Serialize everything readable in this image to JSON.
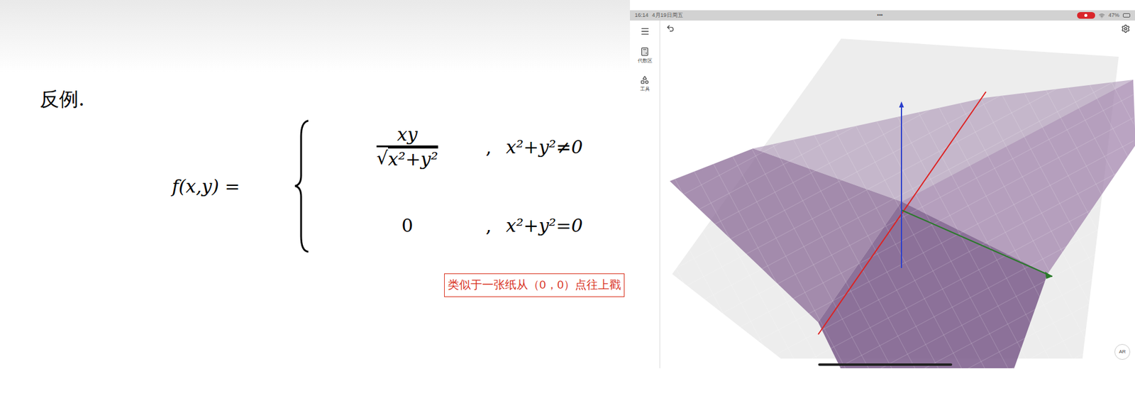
{
  "board": {
    "title": "反例.",
    "formula_lhs": "f(x,y) =",
    "cases": [
      {
        "kind": "fraction",
        "numerator": "xy",
        "radical": "√",
        "denominator": "x²+y²",
        "separator": ",",
        "condition": "x²+y²≠0"
      },
      {
        "kind": "value",
        "value": "0",
        "separator": ",",
        "condition": "x²+y²=0"
      }
    ],
    "caption": "类似于一张纸从（0，0）点往上戳"
  },
  "app": {
    "status_bar": {
      "time": "16:14",
      "date": "4月19日周五",
      "dots": "•••",
      "battery": "47%"
    },
    "sidebar": {
      "items": [
        {
          "label": "代数区"
        },
        {
          "label": "工具"
        }
      ]
    },
    "ar_button": "AR"
  }
}
